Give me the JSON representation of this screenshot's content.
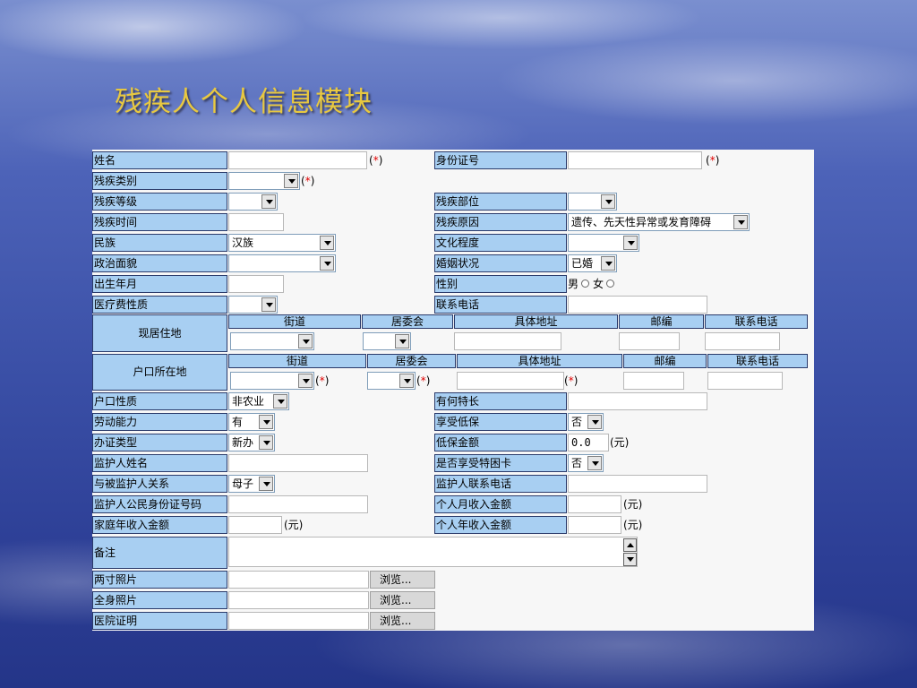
{
  "title": "残疾人个人信息模块",
  "form": {
    "name_label": "姓名",
    "id_label": "身份证号",
    "category_label": "残疾类别",
    "grade_label": "残疾等级",
    "part_label": "残疾部位",
    "time_label": "残疾时间",
    "cause_label": "残疾原因",
    "cause_value": "遗传、先天性异常或发育障碍",
    "ethnic_label": "民族",
    "ethnic_value": "汉族",
    "education_label": "文化程度",
    "political_label": "政治面貌",
    "marital_label": "婚姻状况",
    "marital_value": "已婚",
    "birth_label": "出生年月",
    "gender_label": "性别",
    "gender_male": "男",
    "gender_female": "女",
    "medical_label": "医疗费性质",
    "phone_label": "联系电话",
    "residence_label": "现居住地",
    "hukou_label": "户口所在地",
    "addr_headers": [
      "街道",
      "居委会",
      "具体地址",
      "邮编",
      "联系电话"
    ],
    "hukou_type_label": "户口性质",
    "hukou_type_value": "非农业",
    "specialty_label": "有何特长",
    "labor_label": "劳动能力",
    "labor_value": "有",
    "dibao_label": "享受低保",
    "dibao_value": "否",
    "cert_type_label": "办证类型",
    "cert_type_value": "新办",
    "dibao_amount_label": "低保金额",
    "dibao_amount_value": "0.0",
    "guardian_name_label": "监护人姓名",
    "special_card_label": "是否享受特困卡",
    "special_card_value": "否",
    "relation_label": "与被监护人关系",
    "relation_value": "母子",
    "guardian_phone_label": "监护人联系电话",
    "guardian_id_label": "监护人公民身份证号码",
    "monthly_income_label": "个人月收入金额",
    "family_income_label": "家庭年收入金额",
    "annual_income_label": "个人年收入金额",
    "yuan": "(元)",
    "remarks_label": "备注",
    "photo2_label": "两寸照片",
    "photo_full_label": "全身照片",
    "hospital_label": "医院证明",
    "browse": "浏览...",
    "required_open": "(",
    "required_star": "*",
    "required_close": ")"
  }
}
